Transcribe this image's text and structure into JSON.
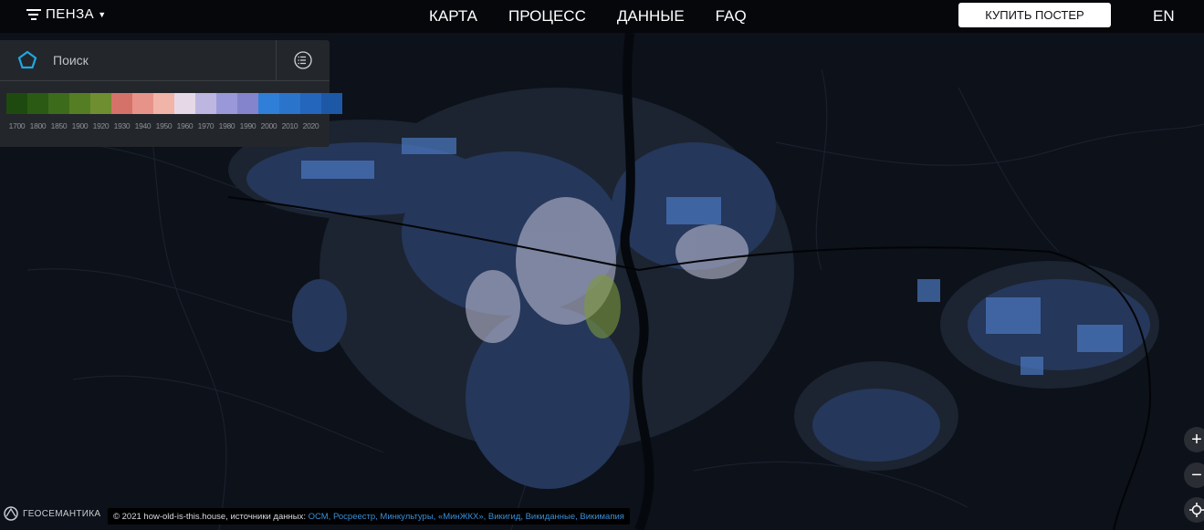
{
  "header": {
    "city": "ПЕНЗА",
    "nav": [
      "КАРТА",
      "ПРОЦЕСС",
      "ДАННЫЕ",
      "FAQ"
    ],
    "poster_button": "КУПИТЬ ПОСТЕР",
    "lang": "EN"
  },
  "search": {
    "placeholder": "Поиск"
  },
  "legend": {
    "colors": [
      "#1e4a0f",
      "#2b5a14",
      "#3d6b1c",
      "#557e24",
      "#6e8e30",
      "#d4726a",
      "#e8938a",
      "#f0b5a8",
      "#e6d8e6",
      "#bdb6e0",
      "#9a98d8",
      "#8484cc",
      "#2f7fd8",
      "#2a74cc",
      "#2466bb",
      "#1d58a6"
    ],
    "labels": [
      "1700",
      "1800",
      "1850",
      "1900",
      "1920",
      "1930",
      "1940",
      "1950",
      "1960",
      "1970",
      "1980",
      "1990",
      "2000",
      "2010",
      "2020"
    ]
  },
  "controls": {
    "zoom_in": "+",
    "zoom_out": "−"
  },
  "footer": {
    "brand": "ГЕОСЕМАНТИКА",
    "copyright": "© 2021 how-old-is-this.house, источники данных:",
    "sources": "ОСМ, Росреестр, Минкультуры, «МинЖКХ», Викигид, Викиданные, Викимапия"
  },
  "colors": {
    "background": "#0c111a",
    "accent": "#2f7fd8",
    "topbar": "#05070b"
  }
}
